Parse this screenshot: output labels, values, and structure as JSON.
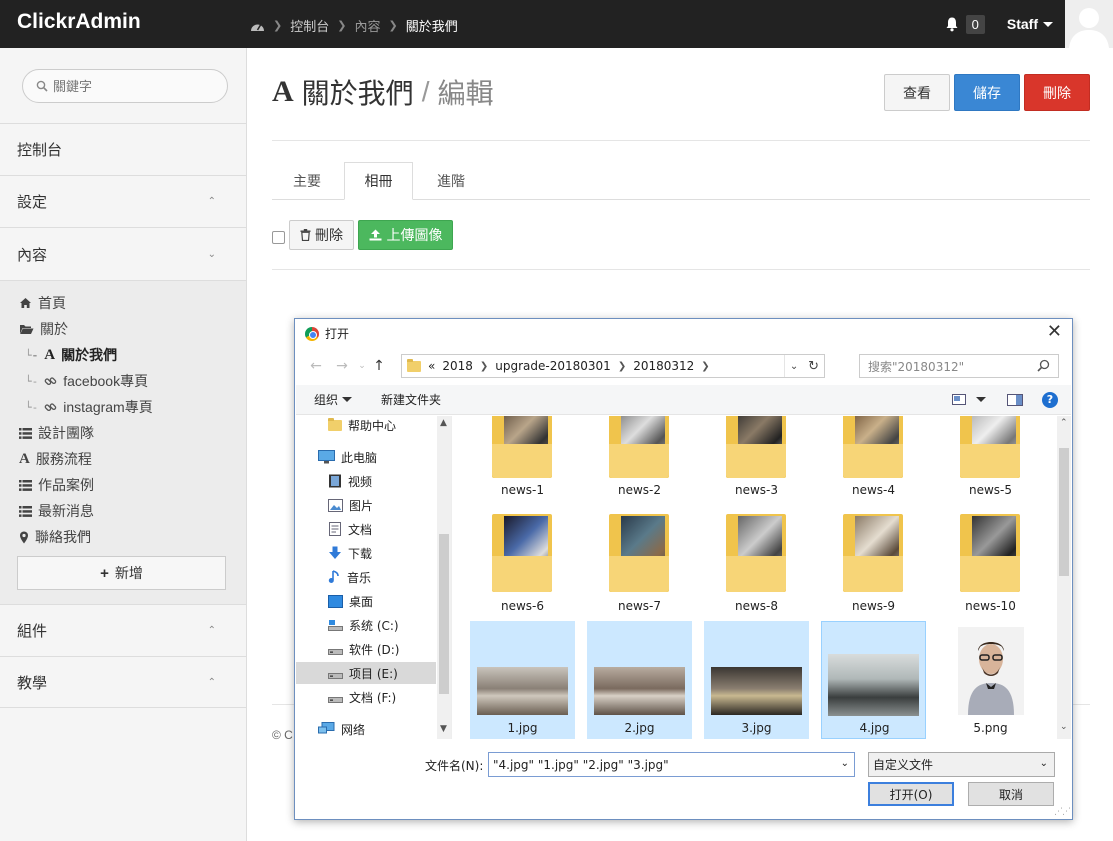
{
  "app": {
    "brand": "ClickrAdmin"
  },
  "breadcrumb": {
    "items": [
      "控制台",
      "內容",
      "關於我們"
    ]
  },
  "header": {
    "notification_count": "0",
    "user_label": "Staff"
  },
  "sidebar": {
    "search_placeholder": "關鍵字",
    "sections": {
      "dashboard": "控制台",
      "settings": "設定",
      "content": "內容",
      "components": "組件",
      "tutorials": "教學"
    },
    "content_items": {
      "home": "首頁",
      "about": "關於",
      "about_us": "關於我們",
      "facebook": "facebook專頁",
      "instagram": "instagram專頁",
      "design_team": "設計團隊",
      "service_flow": "服務流程",
      "works": "作品案例",
      "news": "最新消息",
      "contact": "聯絡我們"
    },
    "add_label": "新增"
  },
  "page": {
    "title": "關於我們",
    "slash": "/",
    "mode": "編輯",
    "buttons": {
      "view": "查看",
      "save": "儲存",
      "delete": "刪除"
    },
    "tabs": [
      "主要",
      "相冊",
      "進階"
    ],
    "album": {
      "delete_label": "刪除",
      "upload_label": "上傳圖像"
    },
    "footer_fragment": "© C"
  },
  "dialog": {
    "title": "打开",
    "path": [
      "«",
      "2018",
      "upgrade-20180301",
      "20180312"
    ],
    "search_placeholder": "搜索\"20180312\"",
    "toolbar": {
      "organize": "组织",
      "new_folder": "新建文件夹"
    },
    "tree": [
      "帮助中心",
      "此电脑",
      "视频",
      "图片",
      "文档",
      "下载",
      "音乐",
      "桌面",
      "系统 (C:)",
      "软件 (D:)",
      "项目 (E:)",
      "文档 (F:)",
      "网络"
    ],
    "folders": [
      "news-1",
      "news-2",
      "news-3",
      "news-4",
      "news-5",
      "news-6",
      "news-7",
      "news-8",
      "news-9",
      "news-10"
    ],
    "images": [
      "1.jpg",
      "2.jpg",
      "3.jpg",
      "4.jpg",
      "5.png"
    ],
    "filename_label": "文件名(N):",
    "filename_value": "\"4.jpg\" \"1.jpg\" \"2.jpg\" \"3.jpg\"",
    "filetype": "自定义文件",
    "open_label": "打开(O)",
    "cancel_label": "取消"
  },
  "colors": {
    "navbar": "#222222",
    "primary": "#3a87d4",
    "danger": "#d9362b",
    "success": "#4cb85e",
    "selection": "#cce8ff"
  }
}
